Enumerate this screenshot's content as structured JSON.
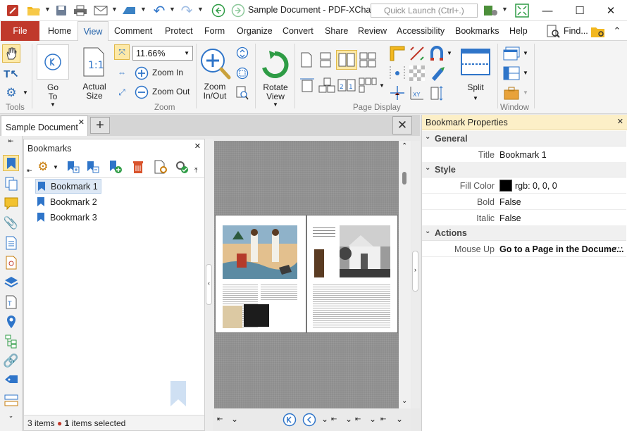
{
  "window": {
    "doc_title": "Sample Document - PDF-XCha...",
    "quick_launch_placeholder": "Quick Launch (Ctrl+.)"
  },
  "menu": {
    "tabs": [
      "File",
      "Home",
      "View",
      "Comment",
      "Protect",
      "Form",
      "Organize",
      "Convert",
      "Share",
      "Review",
      "Accessibility",
      "Bookmarks",
      "Help"
    ],
    "find": "Find...",
    "active_tab": "View"
  },
  "ribbon": {
    "groups": {
      "tools": "Tools",
      "zoom": "Zoom",
      "page_display": "Page Display",
      "window": "Window"
    },
    "go_to": "Go\nTo",
    "actual_size": "Actual\nSize",
    "zoom_value": "11.66%",
    "zoom_in": "Zoom In",
    "zoom_out": "Zoom Out",
    "zoom_in_out": "Zoom\nIn/Out",
    "rotate_view": "Rotate\nView",
    "split": "Split"
  },
  "doc_tab": {
    "label": "Sample Document"
  },
  "bookmarks": {
    "title": "Bookmarks",
    "items": [
      "Bookmark 1",
      "Bookmark 2",
      "Bookmark 3"
    ],
    "selected_index": 0,
    "status_count": "3 items",
    "status_selected_num": "1",
    "status_selected_text": "items selected"
  },
  "properties": {
    "title": "Bookmark Properties",
    "sections": {
      "general": "General",
      "style": "Style",
      "actions": "Actions"
    },
    "rows": {
      "title_key": "Title",
      "title_val": "Bookmark 1",
      "fill_key": "Fill Color",
      "fill_val": "rgb: 0, 0, 0",
      "bold_key": "Bold",
      "bold_val": "False",
      "italic_key": "Italic",
      "italic_val": "False",
      "mouseup_key": "Mouse Up",
      "mouseup_val": "Go to a Page in the Docume..."
    }
  },
  "colors": {
    "file_tab": "#c0392b",
    "accent_blue": "#1f6fc5",
    "props_header": "#fcefc7",
    "selection": "#dde8f5"
  }
}
